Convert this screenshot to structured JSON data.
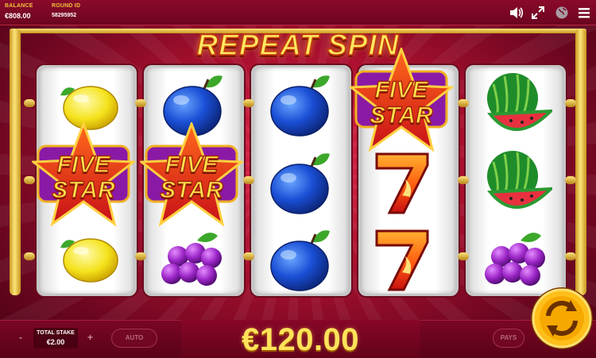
{
  "header": {
    "balance_label": "BALANCE",
    "balance_value": "€808.00",
    "round_label": "ROUND ID",
    "round_value": "58295952",
    "icons": [
      "sound-icon",
      "fullscreen-icon",
      "globe-icon",
      "menu-icon"
    ]
  },
  "banner": {
    "title": "REPEAT SPIN"
  },
  "symbols": {
    "five_star_line1": "FIVE",
    "five_star_line2": "STAR"
  },
  "reels": [
    [
      "lemon",
      "five-star",
      "lemon"
    ],
    [
      "plum",
      "five-star",
      "grapes"
    ],
    [
      "plum",
      "plum",
      "plum"
    ],
    [
      "five-star",
      "seven",
      "seven"
    ],
    [
      "watermelon",
      "watermelon",
      "grapes"
    ]
  ],
  "footer": {
    "minus": "-",
    "plus": "+",
    "stake_label": "TOTAL STAKE",
    "stake_value": "€2.00",
    "auto_label": "AUTO",
    "pays_label": "PAYS",
    "win_amount": "€120.00"
  },
  "colors": {
    "accent_gold": "#ffe35a",
    "background_red": "#a8102e",
    "bar_red": "#6c0420"
  }
}
